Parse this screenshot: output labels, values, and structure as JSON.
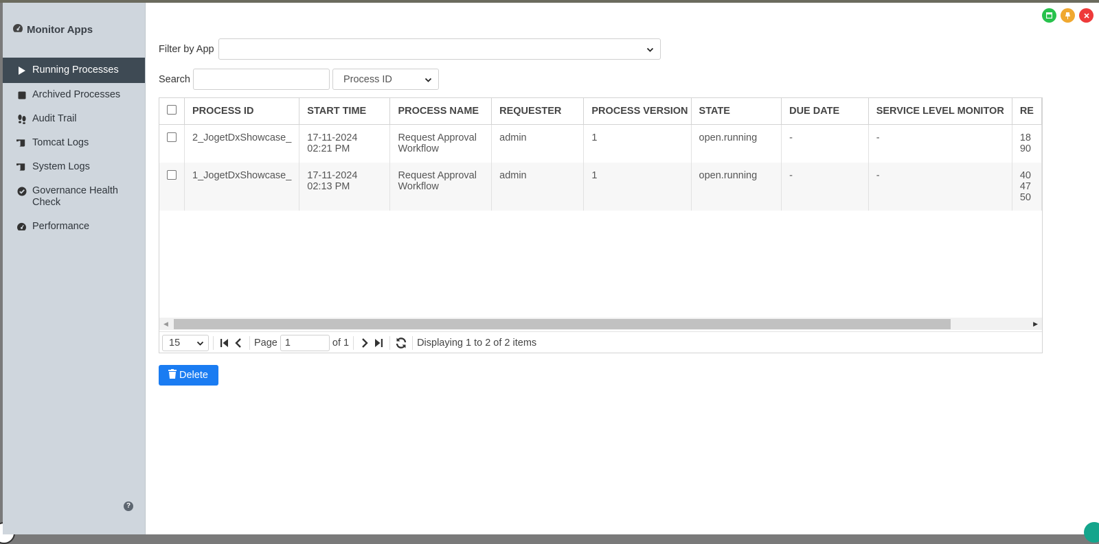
{
  "app": {
    "title": "Monitor Apps"
  },
  "sidebar": {
    "items": [
      {
        "label": "Running Processes",
        "icon": "play-icon",
        "active": true
      },
      {
        "label": "Archived Processes",
        "icon": "stop-icon"
      },
      {
        "label": "Audit Trail",
        "icon": "footprints-icon"
      },
      {
        "label": "Tomcat Logs",
        "icon": "scroll-icon"
      },
      {
        "label": "System Logs",
        "icon": "scroll-icon"
      },
      {
        "label": "Governance Health Check",
        "icon": "check-circle-icon"
      },
      {
        "label": "Performance",
        "icon": "gauge-icon"
      }
    ],
    "help": "?"
  },
  "filter": {
    "label": "Filter by App",
    "value": ""
  },
  "search": {
    "label": "Search",
    "value": "",
    "field": "Process ID"
  },
  "table": {
    "columns": [
      "PROCESS ID",
      "START TIME",
      "PROCESS NAME",
      "REQUESTER",
      "PROCESS VERSION",
      "STATE",
      "DUE DATE",
      "SERVICE LEVEL MONITOR",
      "RE"
    ],
    "rows": [
      {
        "process_id": "2_JogetDxShowcase_",
        "start_time": "17-11-2024 02:21 PM",
        "process_name": "Request Approval Workflow",
        "requester": "admin",
        "version": "1",
        "state": "open.running",
        "due_date": "-",
        "slm": "-",
        "extra": "18 90"
      },
      {
        "process_id": "1_JogetDxShowcase_",
        "start_time": "17-11-2024 02:13 PM",
        "process_name": "Request Approval Workflow",
        "requester": "admin",
        "version": "1",
        "state": "open.running",
        "due_date": "-",
        "slm": "-",
        "extra": "40 47 50"
      }
    ]
  },
  "pager": {
    "page_size": "15",
    "page_label": "Page",
    "page_value": "1",
    "of_label": "of 1",
    "summary": "Displaying 1 to 2 of 2 items"
  },
  "actions": {
    "delete_label": "Delete"
  },
  "colors": {
    "sidebar_bg": "#cfd6dd",
    "active_bg": "#3e4a54",
    "primary": "#1a7cf2"
  }
}
